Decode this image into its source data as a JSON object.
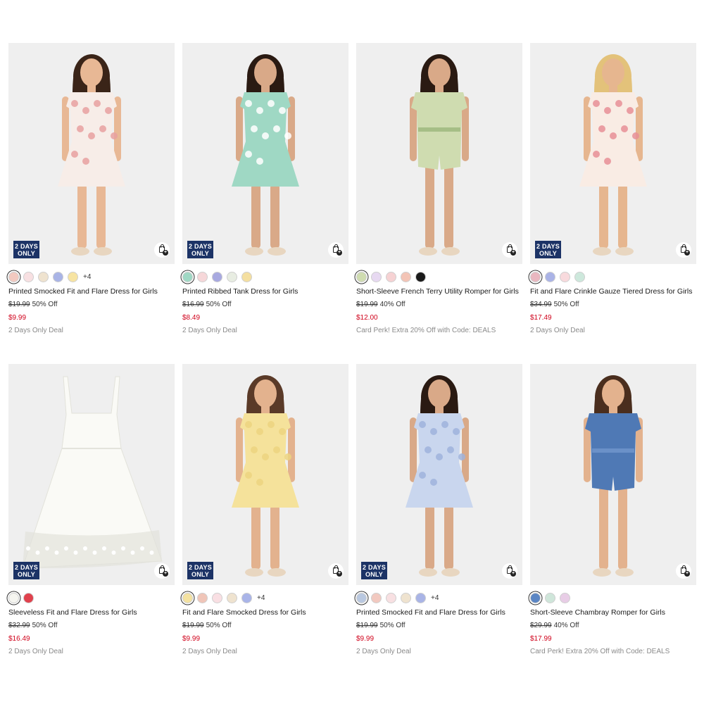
{
  "products": [
    {
      "name": "Printed Smocked Fit and Flare Dress for Girls",
      "badge": "2 DAYS ONLY",
      "original_price": "$19.99",
      "discount": "50% Off",
      "sale_price": "$9.99",
      "deal": "2 Days Only Deal",
      "more_colors": "+4",
      "swatches": [
        "#f2c9c0",
        "#f8e0e2",
        "#efe3cf",
        "#a9b4e6",
        "#f7e4a2"
      ],
      "image": {
        "bg": "#efefef",
        "dress": "#f7ede8",
        "print": "#e8a0a0",
        "skin": "#e8b895",
        "hair": "#3a2418"
      }
    },
    {
      "name": "Printed Ribbed Tank Dress for Girls",
      "badge": "2 DAYS ONLY",
      "original_price": "$16.99",
      "discount": "50% Off",
      "sale_price": "$8.49",
      "deal": "2 Days Only Deal",
      "more_colors": "",
      "swatches": [
        "#9fd8c4",
        "#f6d7d9",
        "#a8a9e0",
        "#e8ede2",
        "#f4dfa0"
      ],
      "image": {
        "bg": "#efefef",
        "dress": "#9fd8c4",
        "print": "#ffffff",
        "skin": "#d9a988",
        "hair": "#2a1a12"
      }
    },
    {
      "name": "Short-Sleeve French Terry Utility Romper for Girls",
      "badge": "",
      "original_price": "$19.99",
      "discount": "40% Off",
      "sale_price": "$12.00",
      "deal": "Card Perk! Extra 20% Off with Code: DEALS",
      "more_colors": "",
      "swatches": [
        "#cfdcb0",
        "#e7d9f1",
        "#f6d2d3",
        "#f3c4b6",
        "#1a1a1a"
      ],
      "image": {
        "bg": "#efefef",
        "dress": "#cfdcb0",
        "print": "#a6be86",
        "skin": "#d9a988",
        "hair": "#2a1a12"
      }
    },
    {
      "name": "Fit and Flare Crinkle Gauze Tiered Dress for Girls",
      "badge": "2 DAYS ONLY",
      "original_price": "$34.99",
      "discount": "50% Off",
      "sale_price": "$17.49",
      "deal": "2 Days Only Deal",
      "more_colors": "",
      "swatches": [
        "#e9b7c0",
        "#aab3e6",
        "#f8dadd",
        "#cde8dc"
      ],
      "image": {
        "bg": "#efefef",
        "dress": "#f9ece4",
        "print": "#e88f96",
        "skin": "#e6b68f",
        "hair": "#e3c27a"
      }
    },
    {
      "name": "Sleeveless Fit and Flare Dress for Girls",
      "badge": "2 DAYS ONLY",
      "original_price": "$32.99",
      "discount": "50% Off",
      "sale_price": "$16.49",
      "deal": "2 Days Only Deal",
      "more_colors": "",
      "swatches": [
        "#f5f5f0",
        "#e0414d"
      ],
      "image": {
        "bg": "#efefef",
        "dress": "#fafaf6",
        "print": "#e3e3dc",
        "skin": "",
        "hair": ""
      }
    },
    {
      "name": "Fit and Flare Smocked Dress for Girls",
      "badge": "2 DAYS ONLY",
      "original_price": "$19.99",
      "discount": "50% Off",
      "sale_price": "$9.99",
      "deal": "2 Days Only Deal",
      "more_colors": "+4",
      "swatches": [
        "#f4e2a0",
        "#f0c5b8",
        "#f9dfe3",
        "#efe3cf",
        "#a9b4e8"
      ],
      "image": {
        "bg": "#efefef",
        "dress": "#f5e29b",
        "print": "#ecd480",
        "skin": "#e3b28e",
        "hair": "#5a3a28"
      }
    },
    {
      "name": "Printed Smocked Fit and Flare Dress for Girls",
      "badge": "2 DAYS ONLY",
      "original_price": "$19.99",
      "discount": "50% Off",
      "sale_price": "$9.99",
      "deal": "2 Days Only Deal",
      "more_colors": "+4",
      "swatches": [
        "#b9c8e0",
        "#f2c9c0",
        "#f8e0e2",
        "#efe3cf",
        "#a9b4e6"
      ],
      "image": {
        "bg": "#efefef",
        "dress": "#c9d6ee",
        "print": "#9fb3dc",
        "skin": "#d9a988",
        "hair": "#2a1a12"
      }
    },
    {
      "name": "Short-Sleeve Chambray Romper for Girls",
      "badge": "",
      "original_price": "$29.99",
      "discount": "40% Off",
      "sale_price": "$17.99",
      "deal": "Card Perk! Extra 20% Off with Code: DEALS",
      "more_colors": "",
      "swatches": [
        "#5b86c4",
        "#cfe6da",
        "#e8cde6"
      ],
      "image": {
        "bg": "#efefef",
        "dress": "#4f79b5",
        "print": "#6b91c8",
        "skin": "#e3b28e",
        "hair": "#4a2e1e"
      }
    }
  ]
}
